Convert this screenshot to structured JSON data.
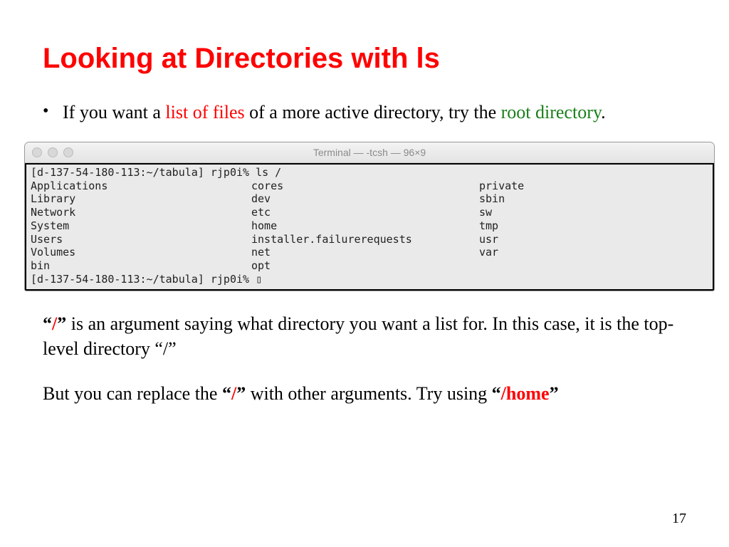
{
  "title": "Looking at Directories with ls",
  "bullet": {
    "pre": "If you want a ",
    "list_of_files": "list of files",
    "mid": " of a more active directory, try the ",
    "root_dir": "root directory",
    "post": "."
  },
  "terminal": {
    "window_title": "Terminal — -tcsh — 96×9",
    "prompt1": "[d-137-54-180-113:~/tabula] rjp0i% ls /",
    "prompt2": "[d-137-54-180-113:~/tabula] rjp0i% ",
    "rows": [
      {
        "c1": "Applications",
        "c2": "cores",
        "c3": "private"
      },
      {
        "c1": "Library",
        "c2": "dev",
        "c3": "sbin"
      },
      {
        "c1": "Network",
        "c2": "etc",
        "c3": "sw"
      },
      {
        "c1": "System",
        "c2": "home",
        "c3": "tmp"
      },
      {
        "c1": "Users",
        "c2": "installer.failurerequests",
        "c3": "usr"
      },
      {
        "c1": "Volumes",
        "c2": "net",
        "c3": "var"
      },
      {
        "c1": "bin",
        "c2": "opt",
        "c3": ""
      }
    ]
  },
  "para1": {
    "q1a": "“",
    "slash": "/",
    "q1b": "”",
    "rest": "  is an argument saying what directory you want a list for. In this case, it is the top-level directory “/”"
  },
  "para2": {
    "pre": "But you can replace the ",
    "q1a": "“",
    "slash": "/",
    "q1b": "”",
    "mid": " with other arguments. Try using ",
    "q2a": "“",
    "home": "/home",
    "q2b": "”"
  },
  "page_number": "17"
}
